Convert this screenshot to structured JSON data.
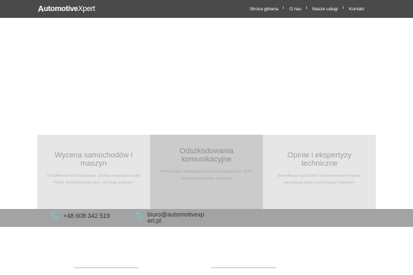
{
  "header": {
    "logo": {
      "part1": "A",
      "part2": "utomotive",
      "part3": "Xpert"
    },
    "nav": [
      {
        "label": "Strona główna"
      },
      {
        "label": "O nas"
      },
      {
        "label": "Nasze usługi"
      },
      {
        "label": "Kontakt"
      }
    ]
  },
  "services": [
    {
      "title": "Wycena samochodów i maszyn",
      "description": "Certyfikowani Rzeczoznawcy. Szybka realizacja w całej Polski. Konkurencyjne ceny. Czy tego szukasz?"
    },
    {
      "title": "Odszkodowania komunikacyjne",
      "description": "Profesjonalna likwidacja szkód komunikacyjnych. 100% zadowolenia klienta. Sprawdź!"
    },
    {
      "title": "Opinie i ekspertyzy techniczne",
      "description": "Identyfikacja uszkodzeń, kosztorysowanie napraw, weryfikacja stanu technicznego. Sprawdź!"
    }
  ],
  "contact": {
    "phone": "+48 608 342 519",
    "email": "biuro@automotivexpert.pl",
    "phone_icon": "phone-icon",
    "email_icon": "tag-icon"
  },
  "colors": {
    "header_bg": "#4a4a4a",
    "contact_bar_bg": "#a3a3a3",
    "icon_accent": "#6fd3d0",
    "box_light": "#e6e6e6",
    "box_dark": "#cbcbcb"
  }
}
